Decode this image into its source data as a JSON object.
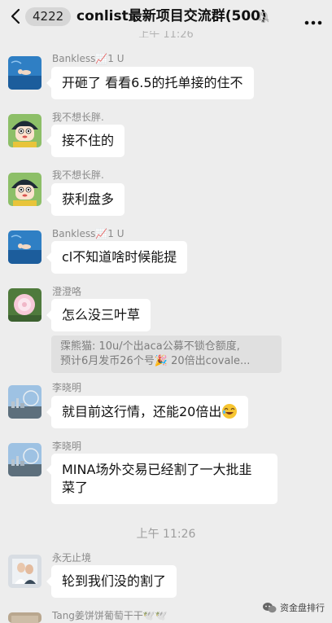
{
  "header": {
    "unread_count": "4222",
    "title": "conlist最新项目交流群(500)"
  },
  "time_top": "上午 11:26",
  "messages": [
    {
      "sender": "Bankless📈1 U",
      "text": "开砸了  看看6.5的托单接的住不"
    },
    {
      "sender": "我不想长胖.",
      "text": "接不住的"
    },
    {
      "sender": "我不想长胖.",
      "text": "获利盘多"
    },
    {
      "sender": "Bankless📈1 U",
      "text": "cl不知道啥时候能提"
    },
    {
      "sender": "澄澄咯",
      "text": "怎么没三叶草",
      "quote_line1": "霂熊猫: 10u/个出aca公募不锁仓额度,",
      "quote_line2": "预计6月发币26个号🎉 20倍出covale..."
    },
    {
      "sender": "李晓明",
      "text": "就目前这行情，还能20倍出"
    },
    {
      "sender": "李晓明",
      "text_line1": "MINA场外交易已经割了一大批韭",
      "text_line2": "菜了"
    },
    {
      "sender": "永无止境",
      "text": "轮到我们没的割了"
    },
    {
      "sender": "Tang姜饼饼葡萄干干🕊️🕊️"
    }
  ],
  "time_separator": "上午 11:26",
  "watermark": "资金盘排行",
  "icons": [
    "back-chevron-icon",
    "mute-bell-icon",
    "more-dots-icon",
    "laughing-emoji-icon",
    "watermark-logo-icon"
  ]
}
